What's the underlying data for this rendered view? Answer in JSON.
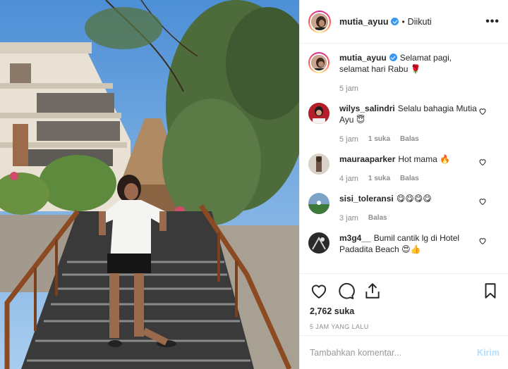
{
  "header": {
    "username": "mutia_ayuu",
    "separator": "•",
    "follow_label": "Diikuti",
    "more_label": "•••"
  },
  "caption": {
    "username": "mutia_ayuu",
    "text": "Selamat pagi, selamat hari Rabu 🌹",
    "time": "5 jam"
  },
  "comments": [
    {
      "username": "wilys_salindri",
      "text": "Selalu bahagia Mutia Ayu 😇",
      "time": "5 jam",
      "likes": "1 suka",
      "reply": "Balas"
    },
    {
      "username": "mauraaparker",
      "text": "Hot mama 🔥",
      "time": "4 jam",
      "likes": "1 suka",
      "reply": "Balas"
    },
    {
      "username": "sisi_toleransi",
      "text": "😋😋😋😋",
      "time": "3 jam",
      "reply": "Balas"
    },
    {
      "username": "m3g4__",
      "text": "Bumil cantik lg di Hotel Padadita Beach 😍👍",
      "time": "",
      "reply": ""
    }
  ],
  "stats": {
    "likes": "2,762 suka",
    "time_ago": "5 JAM YANG LALU"
  },
  "add_comment": {
    "placeholder": "Tambahkan komentar...",
    "post_label": "Kirim"
  },
  "colors": {
    "link_blue": "#3897f0",
    "post_disabled": "#b2dffc",
    "meta_gray": "#8e8e8e",
    "text": "#262626"
  }
}
